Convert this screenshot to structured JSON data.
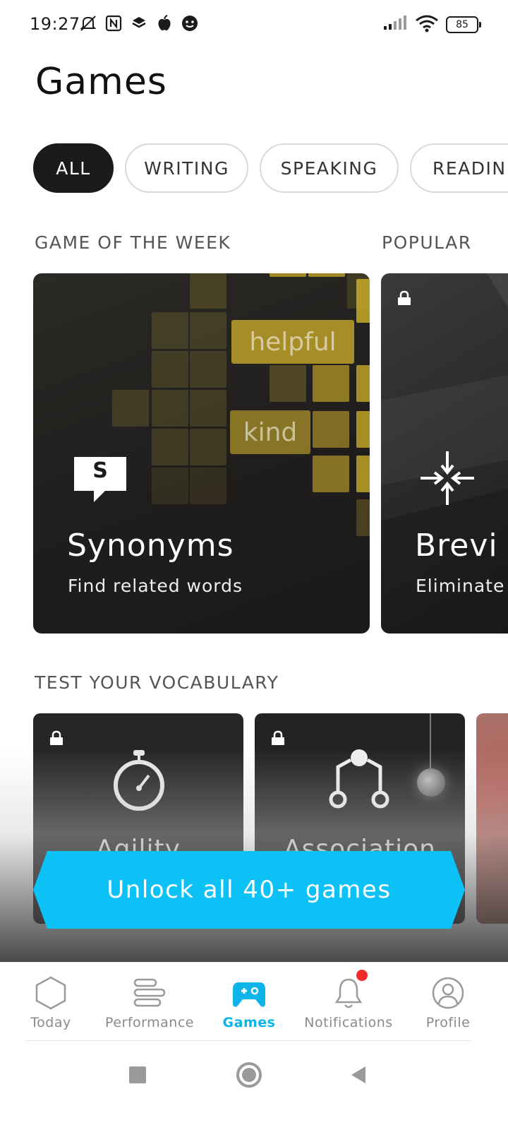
{
  "status_bar": {
    "time": "19:27",
    "battery": "85"
  },
  "page": {
    "title": "Games"
  },
  "filters": [
    {
      "label": "ALL",
      "active": true
    },
    {
      "label": "WRITING",
      "active": false
    },
    {
      "label": "SPEAKING",
      "active": false
    },
    {
      "label": "READIN",
      "active": false
    }
  ],
  "sections": {
    "game_of_week": "GAME OF THE WEEK",
    "popular": "POPULAR",
    "vocabulary": "TEST YOUR VOCABULARY"
  },
  "featured": {
    "synonyms": {
      "title": "Synonyms",
      "subtitle": "Find related words",
      "icon_letter": "S",
      "word1": "helpful",
      "word2": "kind"
    },
    "brevity": {
      "title": "Brevi",
      "subtitle": "Eliminate",
      "locked": true
    }
  },
  "vocabulary_cards": [
    {
      "title": "Agility",
      "locked": true,
      "icon": "stopwatch-icon"
    },
    {
      "title": "Association",
      "locked": true,
      "icon": "association-icon"
    }
  ],
  "unlock_button": "Unlock all 40+ games",
  "bottom_nav": [
    {
      "label": "Today",
      "icon": "hexagon-icon",
      "active": false
    },
    {
      "label": "Performance",
      "icon": "bars-icon",
      "active": false
    },
    {
      "label": "Games",
      "icon": "gamepad-icon",
      "active": true
    },
    {
      "label": "Notifications",
      "icon": "bell-icon",
      "active": false,
      "badge": true
    },
    {
      "label": "Profile",
      "icon": "profile-icon",
      "active": false
    }
  ],
  "colors": {
    "accent": "#0cc1f5",
    "active_nav": "#0cb4ea",
    "badge": "#ef2b2b",
    "chip_active": "#1b1b1b"
  }
}
